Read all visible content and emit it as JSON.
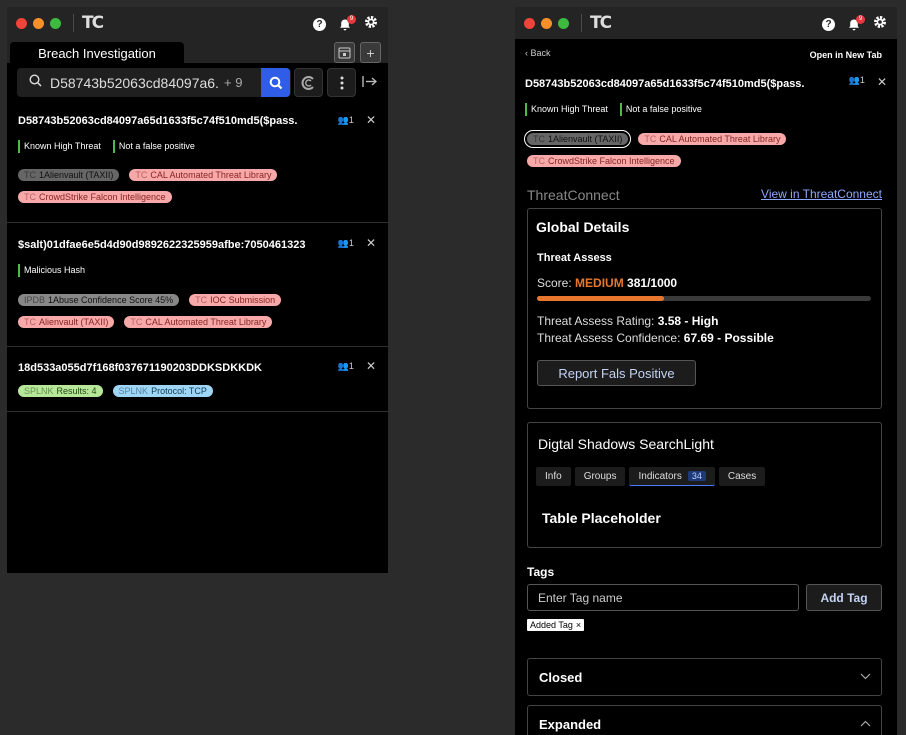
{
  "left": {
    "tab_title": "Breach Investigation",
    "search": {
      "value": "D58743b52063cd84097a6...",
      "more": "+ 9"
    },
    "notifications": "9",
    "cards": [
      {
        "title": "D58743b52063cd84097a65d1633f5c74f510md5($pass.",
        "users": "1",
        "tags": [
          "Known High Threat",
          "Not a false positive"
        ],
        "chips": [
          {
            "prefix": "TC",
            "label": "1Alienvault  (TAXII)",
            "style": "gray"
          },
          {
            "prefix": "TC",
            "label": "CAL Automated Threat Library",
            "style": "pink"
          },
          {
            "prefix": "TC",
            "label": "CrowdStrike Falcon Intelligence",
            "style": "pink"
          }
        ]
      },
      {
        "title": "$salt)01dfae6e5d4d90d9892622325959afbe:7050461323",
        "users": "1",
        "tags": [
          "Malicious Hash"
        ],
        "chips": [
          {
            "prefix": "IPDB",
            "label": "1Abuse Confidence Score 45%",
            "style": "gray2"
          },
          {
            "prefix": "TC",
            "label": "IOC Submission",
            "style": "pink"
          },
          {
            "prefix": "TC",
            "label": "Alienvault (TAXII)",
            "style": "pink"
          },
          {
            "prefix": "TC",
            "label": "CAL Automated Threat Library",
            "style": "pink"
          }
        ]
      },
      {
        "title": "18d533a055d7f168f037671190203DDKSDKKDK",
        "users": "1",
        "tags": [],
        "chips": [
          {
            "prefix": "SPLNK",
            "label": "Results: 4",
            "style": "green"
          },
          {
            "prefix": "SPLNK",
            "label": "Protocol: TCP",
            "style": "blue"
          }
        ]
      }
    ]
  },
  "right": {
    "back": "Back",
    "open_new_tab": "Open in New Tab",
    "title": "D58743b52063cd84097a65d1633f5c74f510md5($pass.",
    "users": "1",
    "tags": [
      "Known High Threat",
      "Not a false positive"
    ],
    "chips": [
      {
        "prefix": "TC",
        "label": "1Alienvault  (TAXII)",
        "style": "gray",
        "selected": true
      },
      {
        "prefix": "TC",
        "label": "CAL Automated Threat Library",
        "style": "pink"
      },
      {
        "prefix": "TC",
        "label": "CrowdStrike Falcon Intelligence",
        "style": "pink"
      }
    ],
    "section": "ThreatConnect",
    "view_link": "View in ThreatConnect",
    "global": {
      "title": "Global Details",
      "assess_title": "Threat Assess",
      "score_label": "Score:",
      "score_level": "MEDIUM",
      "score_value": "381/1000",
      "score_fraction": 0.381,
      "rating_label": "Threat Assess Rating:",
      "rating_value": "3.58 - High",
      "confidence_label": "Threat Assess Confidence:",
      "confidence_value": "67.69 - Possible",
      "report_button": "Report Fals Positive"
    },
    "shadows": {
      "title": "Digtal Shadows SearchLight",
      "tabs": [
        "Info",
        "Groups",
        "Indicators",
        "Cases"
      ],
      "indicator_count": "34",
      "placeholder": "Table Placeholder"
    },
    "tags_section": {
      "title": "Tags",
      "placeholder": "Enter Tag name",
      "add_button": "Add Tag",
      "added_tag": "Added Tag"
    },
    "accordions": [
      "Closed",
      "Expanded"
    ],
    "notifications": "9"
  },
  "colors": {
    "accent": "#2f5de8",
    "score": "#e8772e",
    "link": "#8ea7ff",
    "tag_bar": "#4dbb4a"
  }
}
